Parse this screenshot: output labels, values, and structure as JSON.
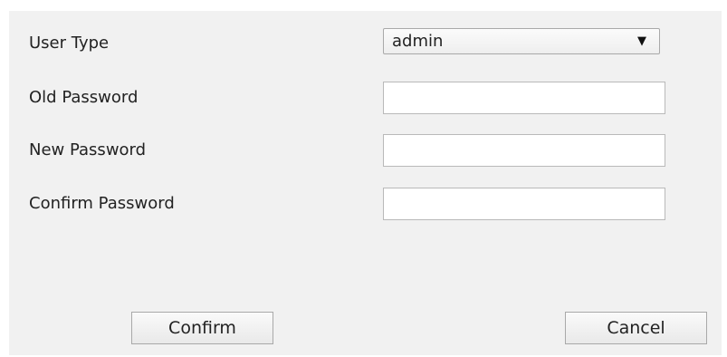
{
  "form": {
    "user_type_label": "User Type",
    "user_type_value": "admin",
    "old_password_label": "Old Password",
    "new_password_label": "New Password",
    "confirm_password_label": "Confirm Password",
    "old_password_value": "",
    "new_password_value": "",
    "confirm_password_value": ""
  },
  "buttons": {
    "confirm_label": "Confirm",
    "cancel_label": "Cancel"
  },
  "icons": {
    "dropdown": "triangle-down-icon"
  }
}
